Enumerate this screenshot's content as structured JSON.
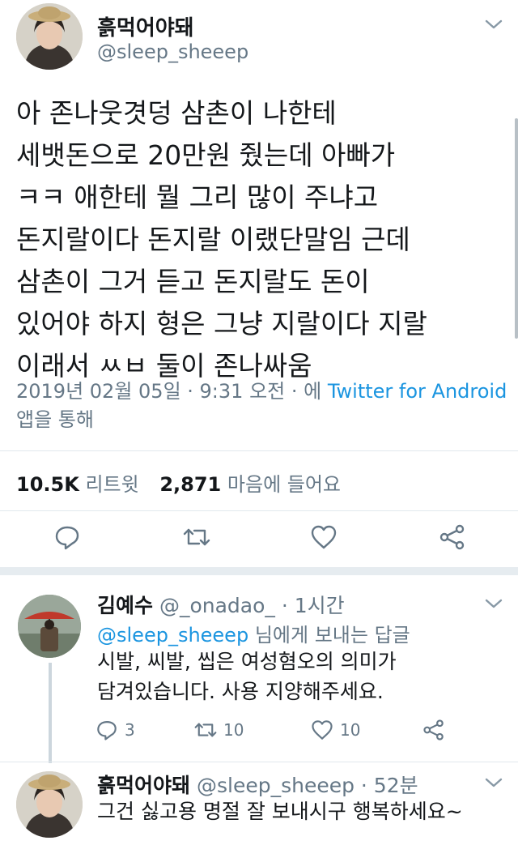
{
  "main_tweet": {
    "display_name": "흙먹어야돼",
    "handle": "@sleep_sheeep",
    "text_lines": [
      "아 존나웃겻덩 삼촌이 나한테",
      "세뱃돈으로 20만원 줬는데 아빠가",
      "ㅋㅋ 애한테 뭘 그리 많이 주냐고",
      "돈지랄이다 돈지랄 이랬단말임 근데",
      "삼촌이 그거 듣고 돈지랄도 돈이",
      "있어야 하지 형은 그냥 지랄이다 지랄",
      "이래서 ㅆㅂ 둘이 존나싸움"
    ],
    "timestamp": "2019년 02월 05일 · 9:31 오전 · 에",
    "source_app": "Twitter for Android",
    "source_suffix": "앱을 통해",
    "retweet_count": "10.5K",
    "retweet_label": "리트윗",
    "like_count": "2,871",
    "like_label": "마음에 들어요"
  },
  "reply": {
    "display_name": "김예수",
    "handle": "@_onadao_",
    "time": "· 1시간",
    "replying_to": "@sleep_sheeep",
    "replying_suffix": "님에게 보내는 답글",
    "text_lines": [
      "시발, 씨발, 씹은 여성혐오의 의미가",
      "담겨있습니다. 사용 지양해주세요."
    ],
    "reply_count": "3",
    "retweet_count": "10",
    "like_count": "10"
  },
  "bottom_reply": {
    "display_name": "흙먹어야돼",
    "handle": "@sleep_sheeep",
    "time": "· 52분",
    "text": "그건 싫고용 명절 잘 보내시구 행복하세요~"
  },
  "colors": {
    "text": "#14171a",
    "secondary": "#657786",
    "link": "#1b95e0",
    "icon": "#657786",
    "divider": "#e1e8ed",
    "separator": "#e6ecf0"
  }
}
